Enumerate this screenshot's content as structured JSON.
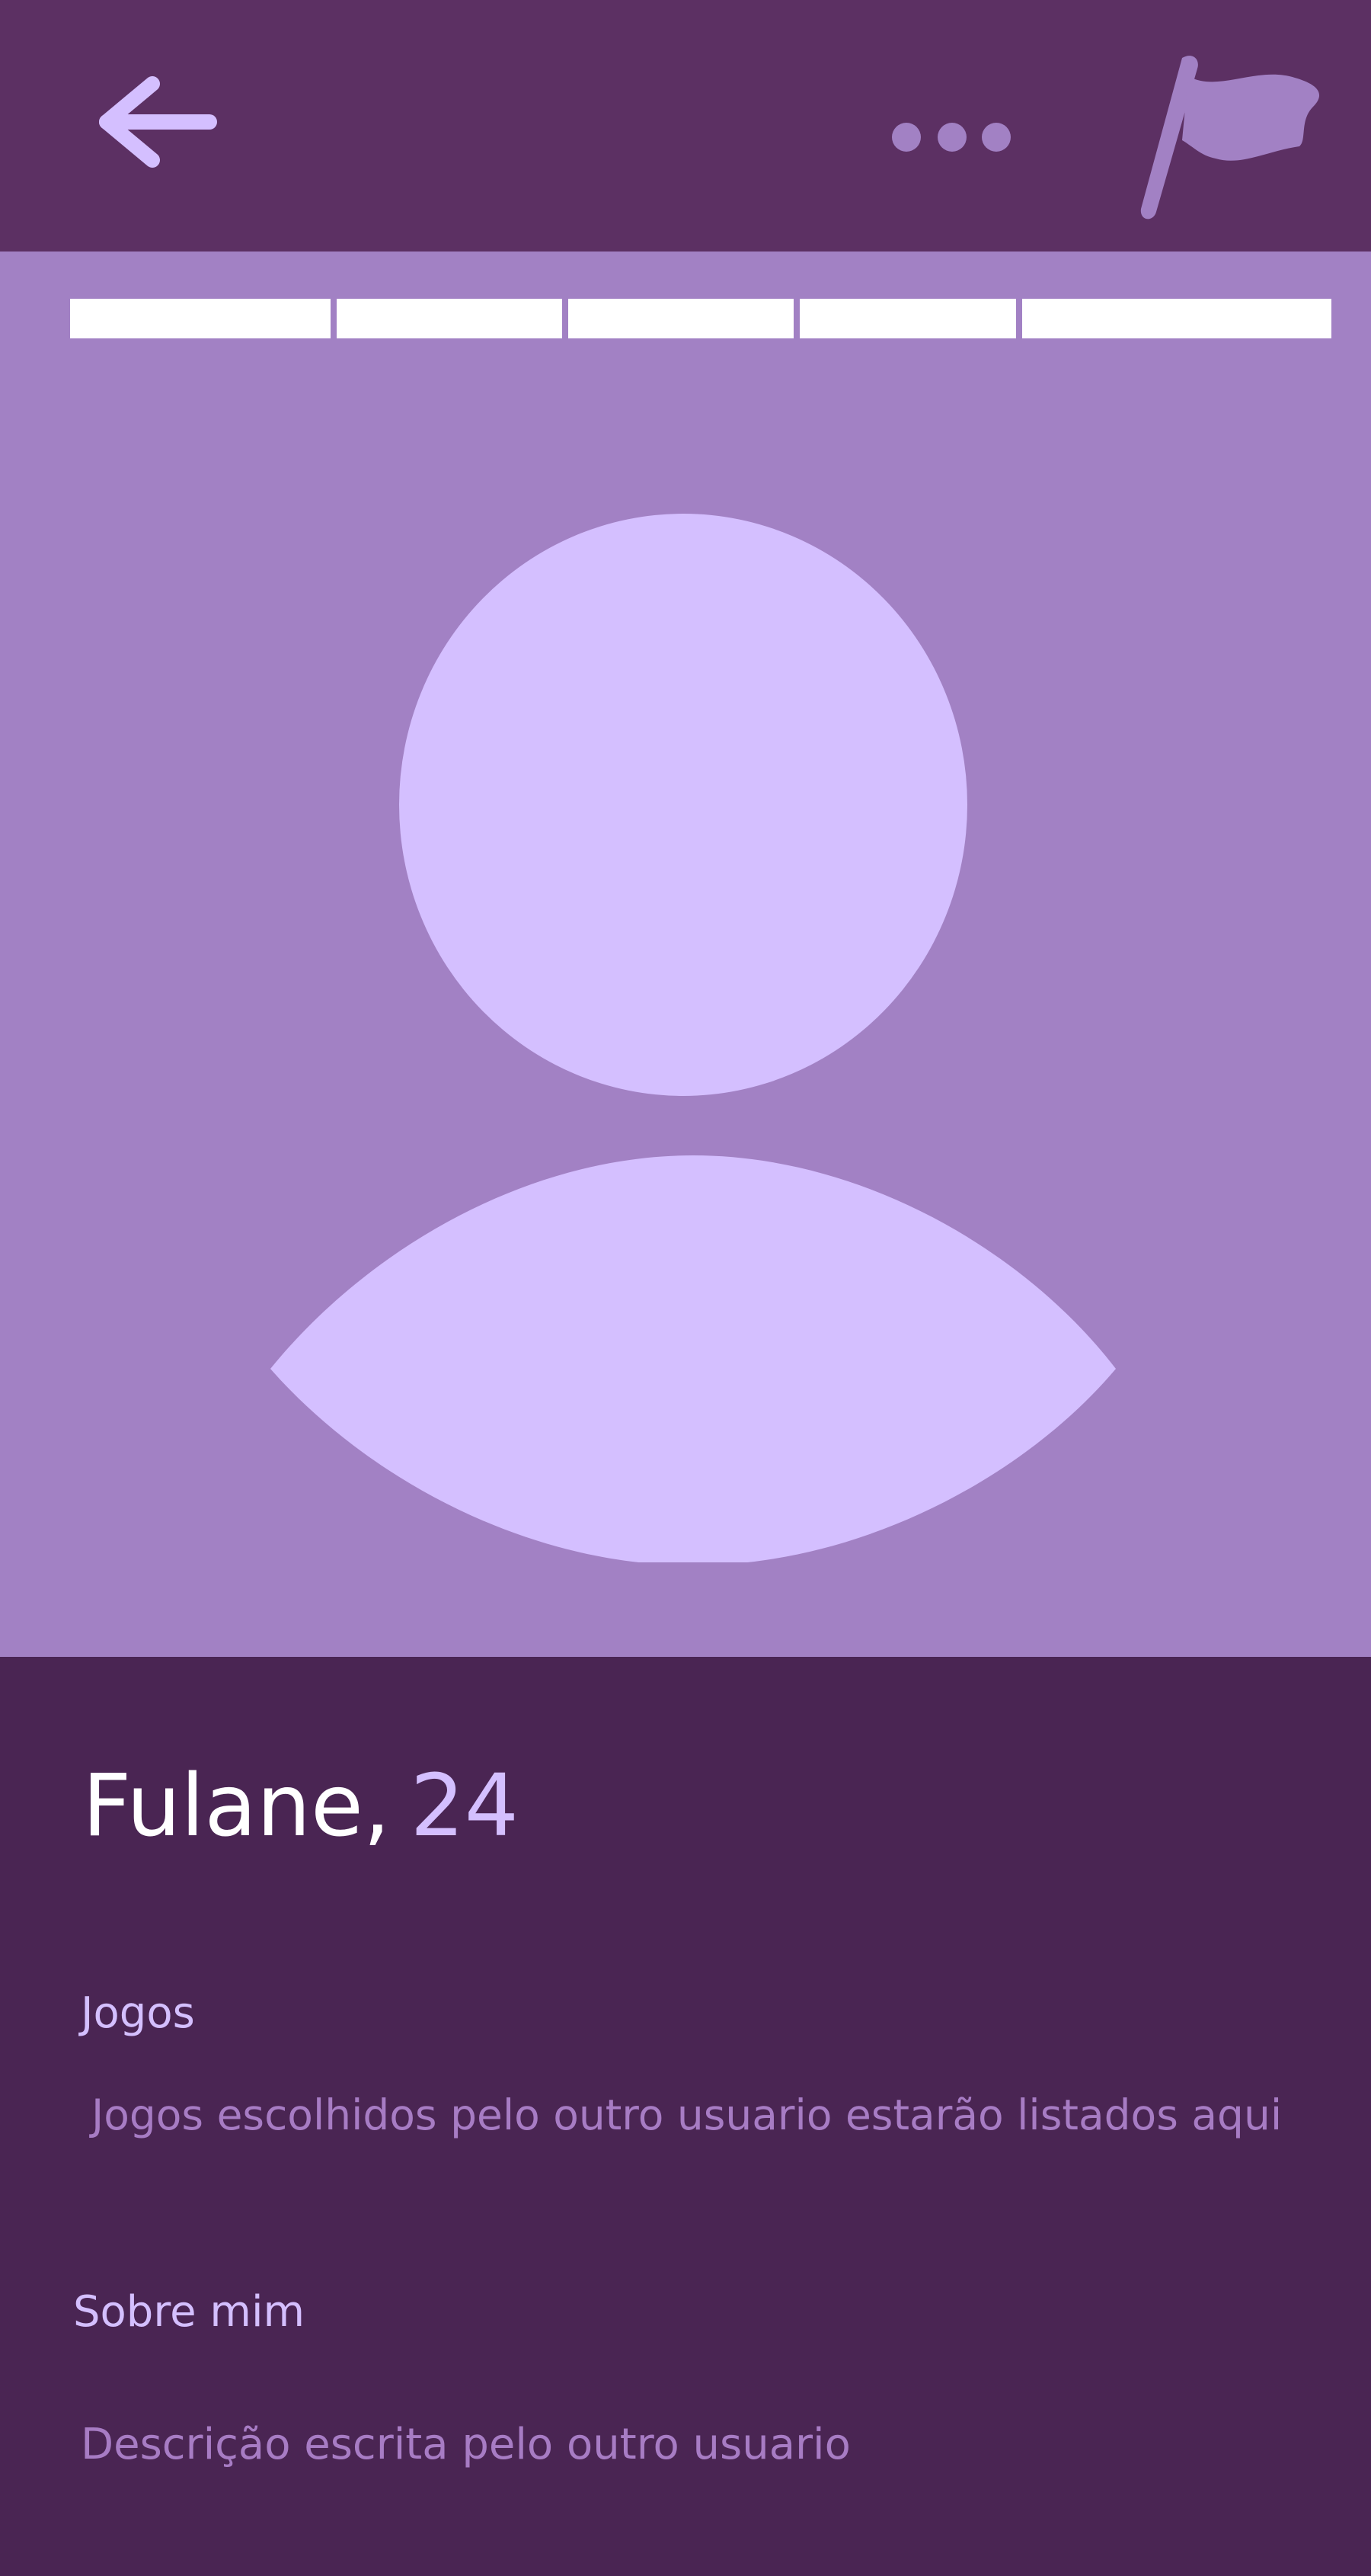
{
  "header": {
    "back_icon": "arrow-left-icon",
    "more_icon": "more-horizontal-icon",
    "report_icon": "flag-icon"
  },
  "photo_gallery": {
    "photo_count": 5,
    "avatar_icon": "person-placeholder-icon"
  },
  "profile": {
    "name": "Fulane",
    "separator": ",",
    "age": "24"
  },
  "sections": {
    "games": {
      "title": "Jogos",
      "text": "Jogos escolhidos pelo outro usuario estarão listados aqui"
    },
    "about": {
      "title": "Sobre mim",
      "text": "Descrição escrita pelo outro usuario"
    }
  },
  "colors": {
    "header_bg": "#5c3063",
    "page_bg": "#4a2553",
    "photo_bg": "#a281c4",
    "avatar_fill": "#d4bfff",
    "accent_text": "#d4bfff",
    "muted_text": "#a77cc4",
    "progress_segment": "#ffffff"
  }
}
